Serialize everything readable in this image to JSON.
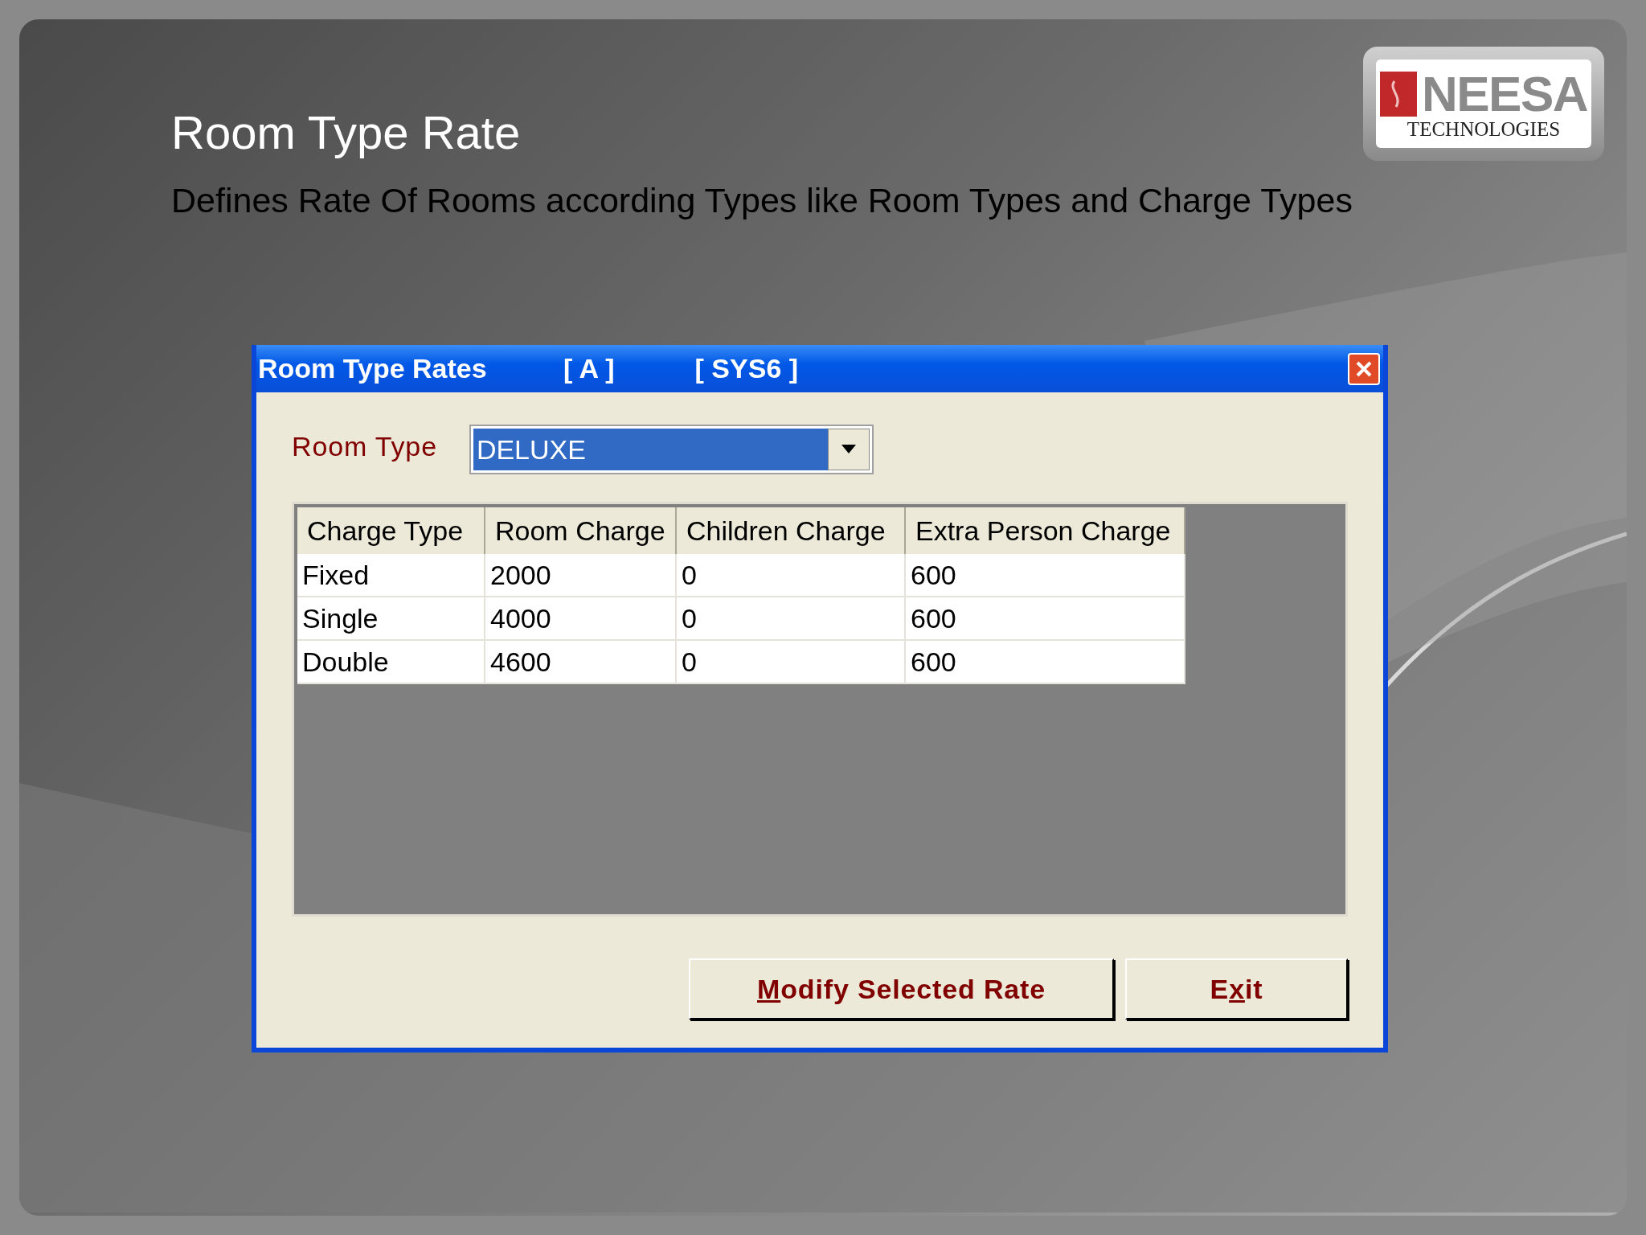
{
  "slide": {
    "title": "Room Type Rate",
    "subtitle": "Defines Rate Of Rooms according Types like Room Types and Charge Types"
  },
  "logo": {
    "name": "NEESA",
    "tagline": "TECHNOLOGIES"
  },
  "window": {
    "title": "Room Type Rates",
    "tags": [
      "[ A ]",
      "[ SYS6 ]"
    ]
  },
  "room_type": {
    "label": "Room Type",
    "value": "DELUXE"
  },
  "table": {
    "columns": [
      "Charge Type",
      "Room Charge",
      "Children Charge",
      "Extra Person Charge"
    ],
    "rows": [
      [
        "Fixed",
        "2000",
        "0",
        "600"
      ],
      [
        "Single",
        "4000",
        "0",
        "600"
      ],
      [
        "Double",
        "4600",
        "0",
        "600"
      ]
    ]
  },
  "buttons": [
    {
      "key": "M",
      "after": "odify Selected Rate"
    },
    {
      "before": "E",
      "key": "x",
      "after": "it"
    }
  ]
}
